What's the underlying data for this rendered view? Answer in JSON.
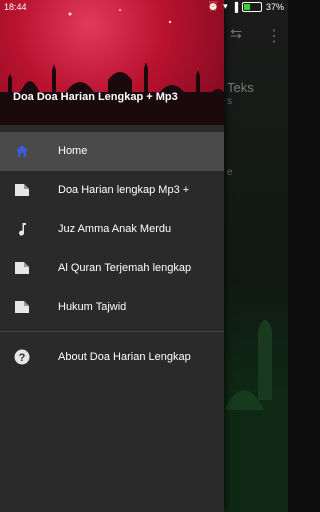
{
  "status": {
    "time": "18:44",
    "battery": "37%"
  },
  "background": {
    "text_line_1": "Teks",
    "text_line_2": "s",
    "text_line_3": "e"
  },
  "drawer": {
    "header_title": "Doa Doa Harian Lengkap + Mp3",
    "items": [
      {
        "label": "Home",
        "icon": "home-icon",
        "selected": true
      },
      {
        "label": "Doa Harian lengkap Mp3 +",
        "icon": "file-icon"
      },
      {
        "label": "Juz Amma Anak Merdu",
        "icon": "music-note-icon"
      },
      {
        "label": "Al Quran Terjemah lengkap",
        "icon": "file-icon"
      },
      {
        "label": "Hukum Tajwid",
        "icon": "file-icon"
      }
    ],
    "about": {
      "label": "About Doa Harian Lengkap",
      "icon": "help-icon"
    }
  },
  "colors": {
    "header": "#b8122f",
    "drawer_bg": "#2a2a2a",
    "selected": "#4a4a4a",
    "home_icon": "#3b5bdb"
  }
}
